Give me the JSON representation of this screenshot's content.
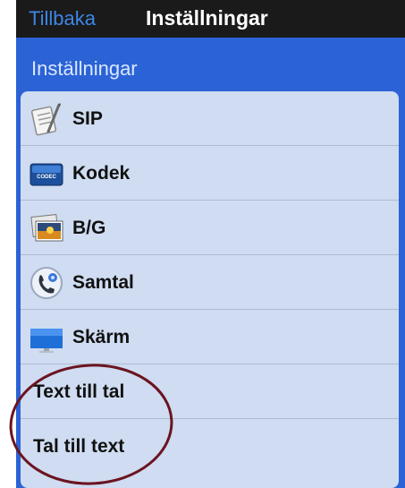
{
  "navbar": {
    "back_label": "Tillbaka",
    "title": "Inställningar"
  },
  "section": {
    "header": "Inställningar"
  },
  "items": [
    {
      "label": "SIP",
      "icon": "notepad-icon"
    },
    {
      "label": "Kodek",
      "icon": "codec-icon"
    },
    {
      "label": "B/G",
      "icon": "photo-icon"
    },
    {
      "label": "Samtal",
      "icon": "phone-icon"
    },
    {
      "label": "Skärm",
      "icon": "monitor-icon"
    },
    {
      "label": "Text till tal"
    },
    {
      "label": "Tal till text"
    }
  ],
  "codec_icon_text": "CODEC",
  "colors": {
    "navbar_bg": "#1a1a1a",
    "back_link": "#3d86e6",
    "panel_bg": "#2b63d6",
    "list_bg": "#cfdcf1",
    "annotation": "#6b1420"
  }
}
